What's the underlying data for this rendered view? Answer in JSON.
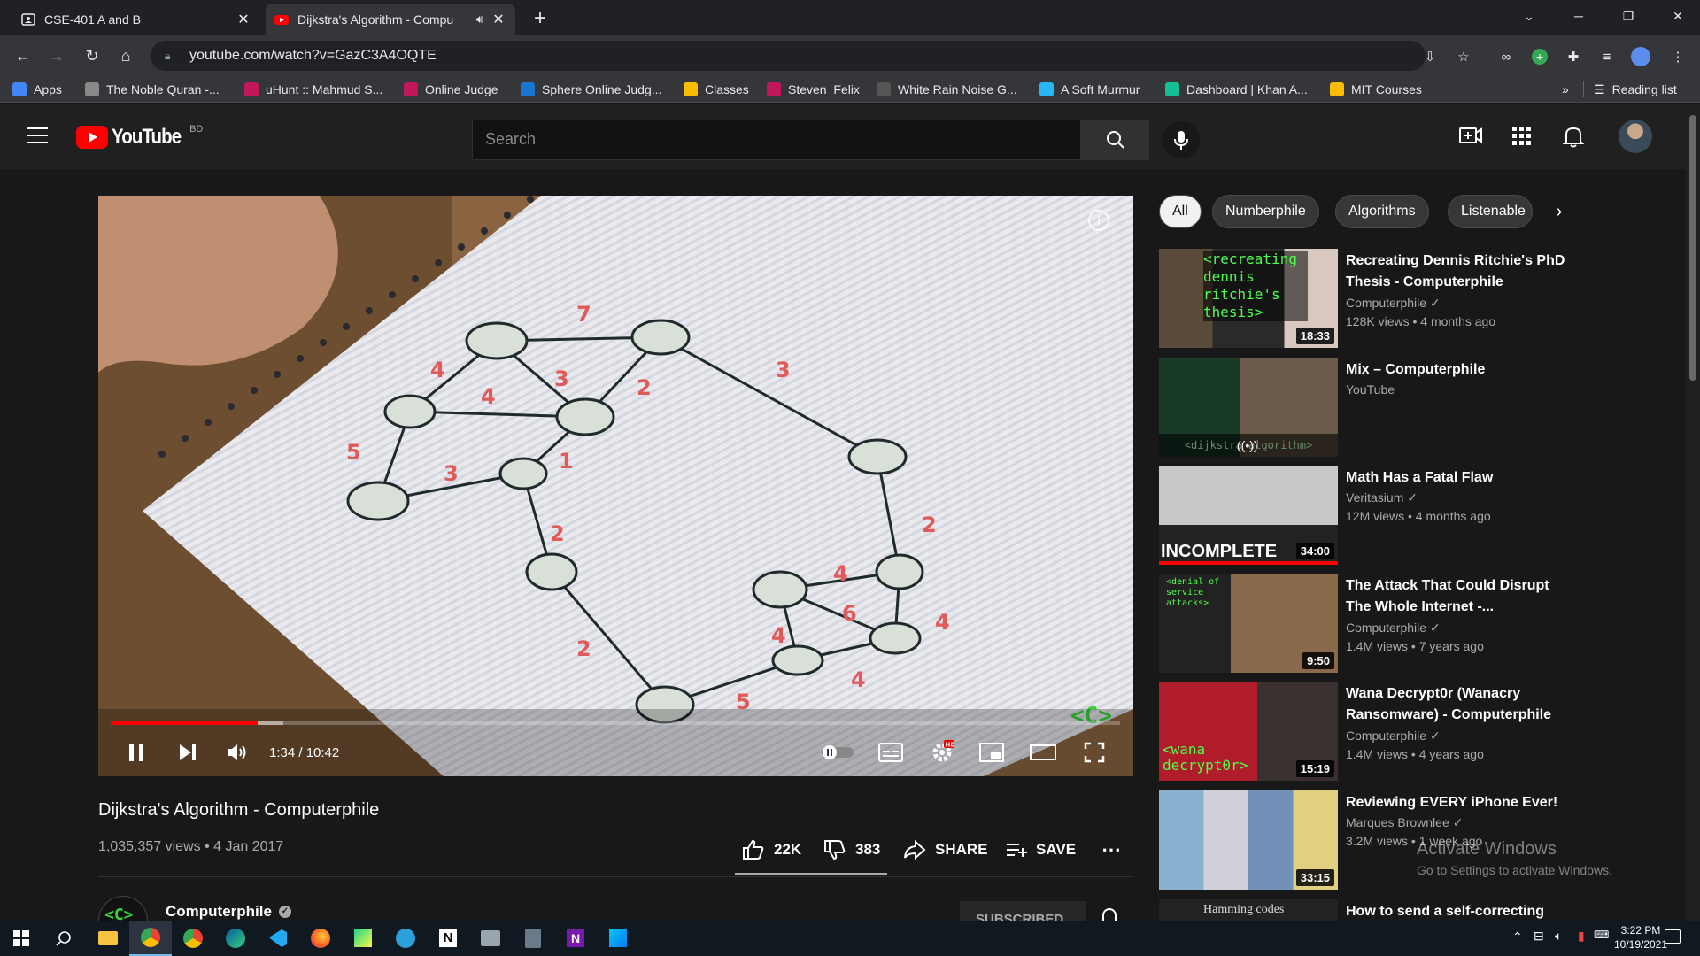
{
  "browser": {
    "tabs": [
      {
        "title": "CSE-401 A and B",
        "active": false
      },
      {
        "title": "Dijkstra's Algorithm - Compu",
        "active": true
      }
    ],
    "new_tab_label": "+",
    "url": "youtube.com/watch?v=GazC3A4OQTE",
    "bookmarks": [
      {
        "label": "Apps",
        "color": "#4285f4"
      },
      {
        "label": "The Noble Quran -...",
        "color": "#888888"
      },
      {
        "label": "uHunt :: Mahmud S...",
        "color": "#c2185b"
      },
      {
        "label": "Online Judge",
        "color": "#c2185b"
      },
      {
        "label": "Sphere Online Judg...",
        "color": "#1976d2"
      },
      {
        "label": "Classes",
        "color": "#fbbc04"
      },
      {
        "label": "Steven_Felix",
        "color": "#c2185b"
      },
      {
        "label": "White Rain Noise G...",
        "color": "#555555"
      },
      {
        "label": "A Soft Murmur",
        "color": "#29b6f6"
      },
      {
        "label": "Dashboard | Khan A...",
        "color": "#14bf96"
      },
      {
        "label": "MIT Courses",
        "color": "#fbbc04"
      }
    ],
    "bookmarks_overflow": "»",
    "reading_list": "Reading list"
  },
  "youtube": {
    "logo_text": "YouTube",
    "region": "BD",
    "search_placeholder": "Search",
    "video": {
      "title": "Dijkstra's Algorithm - Computerphile",
      "meta": "1,035,357 views • 4 Jan 2017",
      "time": "1:34 / 10:42",
      "progress": 0.146,
      "likes": "22K",
      "dislikes": "383",
      "share": "SHARE",
      "save": "SAVE",
      "more": "⋯",
      "channel": "Computerphile",
      "subscribe": "SUBSCRIBED",
      "info_icon": "i"
    },
    "chips": [
      "All",
      "Numberphile",
      "Algorithms",
      "Listenable"
    ],
    "recommended": [
      {
        "title": "Recreating Dennis Ritchie's PhD Thesis - Computerphile",
        "channel": "Computerphile",
        "verified": true,
        "views": "128K views • 4 months ago",
        "duration": "18:33"
      },
      {
        "title": "Mix – Computerphile",
        "channel": "YouTube",
        "verified": false,
        "views": "",
        "duration": ""
      },
      {
        "title": "Math Has a Fatal Flaw",
        "channel": "Veritasium",
        "verified": true,
        "views": "12M views • 4 months ago",
        "duration": "34:00"
      },
      {
        "title": "The Attack That Could Disrupt The Whole Internet -...",
        "channel": "Computerphile",
        "verified": true,
        "views": "1.4M views • 7 years ago",
        "duration": "9:50"
      },
      {
        "title": "Wana Decrypt0r (Wanacry Ransomware) - Computerphile",
        "channel": "Computerphile",
        "verified": true,
        "views": "1.4M views • 4 years ago",
        "duration": "15:19"
      },
      {
        "title": "Reviewing EVERY iPhone Ever!",
        "channel": "Marques Brownlee",
        "verified": true,
        "views": "3.2M views • 1 week ago",
        "duration": "33:15"
      },
      {
        "title": "How to send a self-correcting",
        "channel": "",
        "verified": false,
        "views": "",
        "duration": ""
      }
    ],
    "thumb_text": {
      "ritchie": "<recreating dennis ritchie's thesis>",
      "mix_overlay": "<dijkstra algorithm>",
      "incomplete": "INCOMPLETE",
      "dos": "<denial of service attacks>",
      "wana": "<wana decrypt0r>",
      "hamming": "Hamming codes"
    }
  },
  "watermark": {
    "line1": "Activate Windows",
    "line2": "Go to Settings to activate Windows."
  },
  "taskbar": {
    "time": "3:22 PM",
    "date": "10/19/2021"
  },
  "colors": {
    "yt_red": "#ff0000",
    "bg": "#181818",
    "header": "#202020"
  }
}
